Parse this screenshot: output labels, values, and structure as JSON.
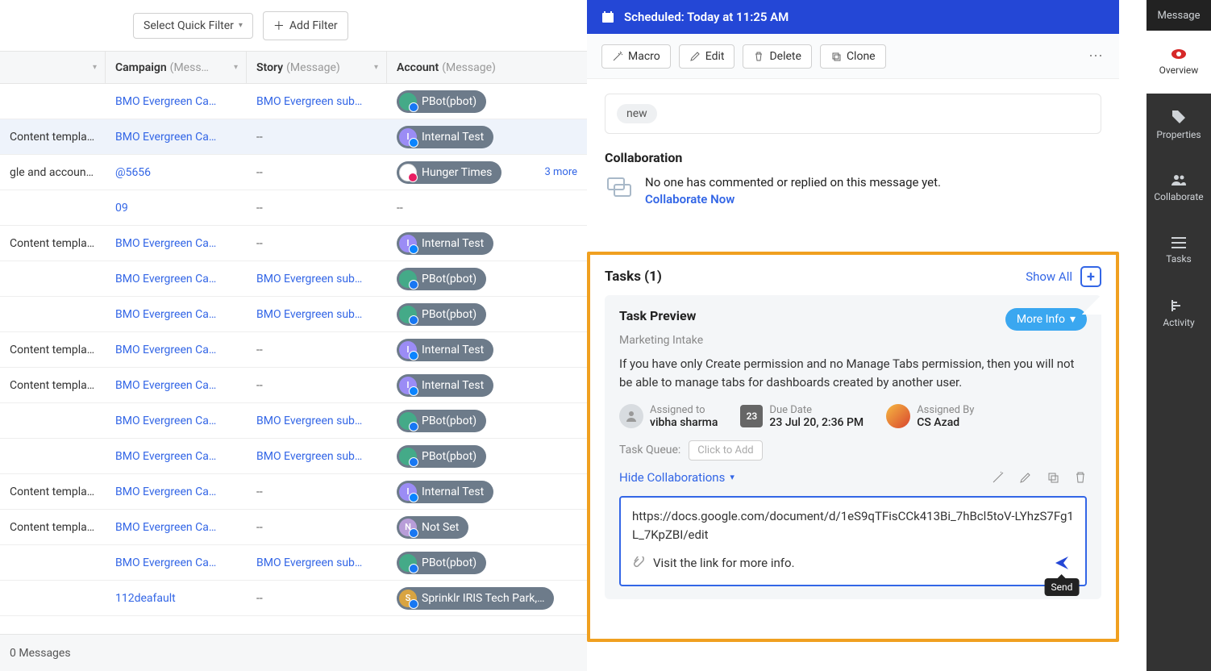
{
  "filters": {
    "quick_filter": "Select Quick Filter",
    "add_filter": "Add Filter"
  },
  "columns": {
    "campaign": {
      "label": "Campaign",
      "meta": "(Mess…"
    },
    "story": {
      "label": "Story",
      "meta": "(Message)"
    },
    "account": {
      "label": "Account",
      "meta": "(Message)"
    }
  },
  "rows": [
    {
      "t": "",
      "c": "BMO Evergreen Ca…",
      "s": "BMO Evergreen sub…",
      "a": "PBot(pbot)",
      "at": "pbot"
    },
    {
      "t": "Content template",
      "c": "BMO Evergreen Ca…",
      "s": "--",
      "a": "Internal Test",
      "at": "purple",
      "sel": true
    },
    {
      "t": "gle and account gr…",
      "c": "@5656",
      "s": "--",
      "a": "Hunger Times",
      "at": "hunger",
      "extra": "3 more"
    },
    {
      "t": "",
      "c": "09",
      "s": "--",
      "a": "--",
      "at": "none"
    },
    {
      "t": "Content template",
      "c": "BMO Evergreen Ca…",
      "s": "--",
      "a": "Internal Test",
      "at": "purple"
    },
    {
      "t": "",
      "c": "BMO Evergreen Ca…",
      "s": "BMO Evergreen sub…",
      "a": "PBot(pbot)",
      "at": "pbot"
    },
    {
      "t": "",
      "c": "BMO Evergreen Ca…",
      "s": "BMO Evergreen sub…",
      "a": "PBot(pbot)",
      "at": "pbot"
    },
    {
      "t": "Content template",
      "c": "BMO Evergreen Ca…",
      "s": "--",
      "a": "Internal Test",
      "at": "purple"
    },
    {
      "t": "Content template",
      "c": "BMO Evergreen Ca…",
      "s": "--",
      "a": "Internal Test",
      "at": "purple"
    },
    {
      "t": "",
      "c": "BMO Evergreen Ca…",
      "s": "BMO Evergreen sub…",
      "a": "PBot(pbot)",
      "at": "pbot"
    },
    {
      "t": "",
      "c": "BMO Evergreen Ca…",
      "s": "BMO Evergreen sub…",
      "a": "PBot(pbot)",
      "at": "pbot"
    },
    {
      "t": "Content template",
      "c": "BMO Evergreen Ca…",
      "s": "--",
      "a": "Internal Test",
      "at": "purple"
    },
    {
      "t": "Content template",
      "c": "BMO Evergreen Ca…",
      "s": "--",
      "a": "Not Set",
      "at": "notset"
    },
    {
      "t": "",
      "c": "BMO Evergreen Ca…",
      "s": "BMO Evergreen sub…",
      "a": "PBot(pbot)",
      "at": "pbot"
    },
    {
      "t": "",
      "c": "112deafault",
      "s": "--",
      "a": "Sprinklr IRIS Tech Park,…",
      "at": "iris"
    }
  ],
  "footer_count": "0 Messages",
  "scheduled": "Scheduled: Today at 11:25 AM",
  "actions": {
    "macro": "Macro",
    "edit": "Edit",
    "delete": "Delete",
    "clone": "Clone"
  },
  "new_label": "new",
  "collab": {
    "heading": "Collaboration",
    "empty": "No one has commented or replied on this message yet.",
    "cta": "Collaborate Now"
  },
  "tasks": {
    "heading": "Tasks (1)",
    "show_all": "Show All",
    "title": "Task Preview",
    "subtitle": "Marketing Intake",
    "more_info": "More Info",
    "desc": "If you have only Create permission and no Manage Tabs permission, then you will not be able to manage tabs for dashboards created by another user.",
    "assigned_to_k": "Assigned to",
    "assigned_to_v": "vibha sharma",
    "due_k": "Due Date",
    "due_v": "23 Jul 20, 2:36 PM",
    "due_day": "23",
    "assigned_by_k": "Assigned By",
    "assigned_by_v": "CS Azad",
    "queue_label": "Task Queue:",
    "queue_cta": "Click to Add",
    "hide_collab": "Hide Collaborations",
    "compose_url": "https://docs.google.com/document/d/1eS9qTFisCCk413Bi_7hBcl5toV-LYhzS7Fg1L_7KpZBI/edit",
    "compose_note": "Visit the link for more info.",
    "send_tooltip": "Send"
  },
  "rail": {
    "top": "Message",
    "overview": "Overview",
    "properties": "Properties",
    "collaborate": "Collaborate",
    "tasks": "Tasks",
    "activity": "Activity"
  }
}
